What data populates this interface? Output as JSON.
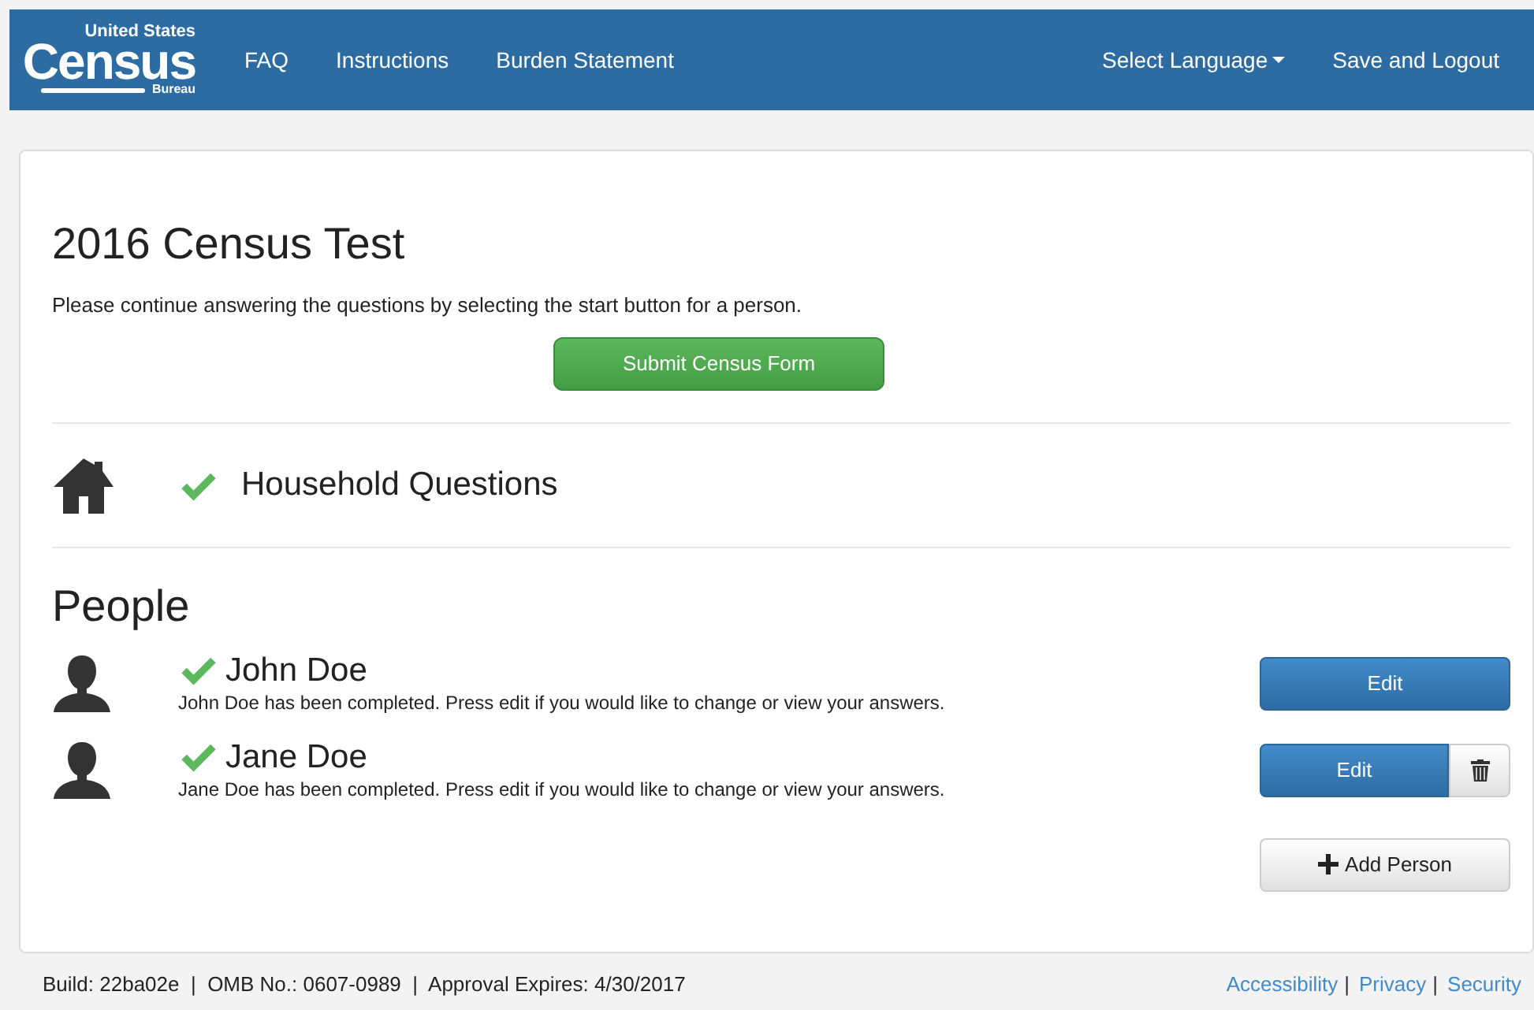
{
  "logo": {
    "top": "United States",
    "main": "Census",
    "bottom": "Bureau"
  },
  "nav": {
    "left": [
      {
        "label": "FAQ"
      },
      {
        "label": "Instructions"
      },
      {
        "label": "Burden Statement"
      }
    ],
    "right": [
      {
        "label": "Select Language",
        "dropdown": true
      },
      {
        "label": "Save and Logout",
        "dropdown": false
      }
    ]
  },
  "title": "2016 Census Test",
  "intro": "Please continue answering the questions by selecting the start button for a person.",
  "submit_button": "Submit Census Form",
  "household": {
    "label": "Household Questions",
    "completed": true
  },
  "people_heading": "People",
  "people": [
    {
      "name": "John Doe",
      "completed": true,
      "status": "John Doe has been completed. Press edit if you would like to change or view your answers.",
      "edit_button": "Edit",
      "deletable": false
    },
    {
      "name": "Jane Doe",
      "completed": true,
      "status": "Jane Doe has been completed. Press edit if you would like to change or view your answers.",
      "edit_button": "Edit",
      "deletable": true
    }
  ],
  "add_button": "Add Person",
  "footer": {
    "info": "Build: 22ba02e  |  OMB No.: 0607-0989  |  Approval Expires: 4/30/2017",
    "separator": "|",
    "links": [
      {
        "label": "Accessibility"
      },
      {
        "label": "Privacy"
      },
      {
        "label": "Security"
      }
    ]
  }
}
